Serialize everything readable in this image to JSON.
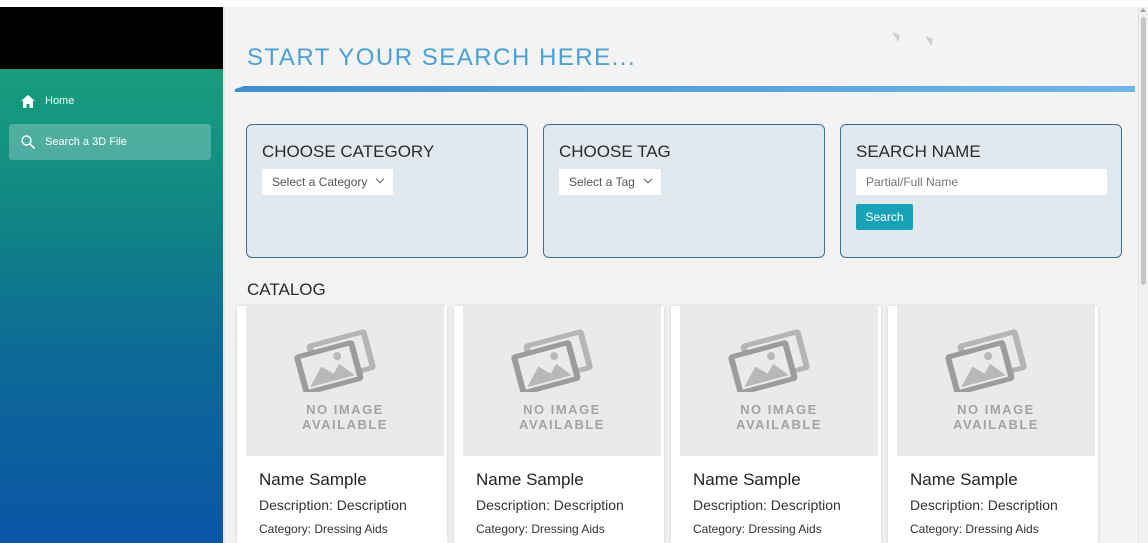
{
  "sidebar": {
    "items": [
      {
        "label": "Home",
        "icon": "home-icon"
      },
      {
        "label": "Search a 3D File",
        "icon": "search-icon"
      }
    ],
    "colors": {
      "gradient_top": "#1aa57e",
      "gradient_bottom": "#0b55a6"
    }
  },
  "main": {
    "title": "START YOUR SEARCH HERE...",
    "filters": {
      "category": {
        "title": "CHOOSE CATEGORY",
        "select_value": "Select a Category"
      },
      "tag": {
        "title": "CHOOSE TAG",
        "select_value": "Select a Tag"
      },
      "name": {
        "title": "SEARCH NAME",
        "placeholder": "Partial/Full Name",
        "button_label": "Search"
      }
    },
    "catalog": {
      "title": "CATALOG",
      "no_image_line1": "NO IMAGE",
      "no_image_line2": "AVAILABLE",
      "cards": [
        {
          "name": "Name Sample",
          "description": "Description: Description",
          "category": "Category: Dressing Aids"
        },
        {
          "name": "Name Sample",
          "description": "Description: Description",
          "category": "Category: Dressing Aids"
        },
        {
          "name": "Name Sample",
          "description": "Description: Description",
          "category": "Category: Dressing Aids"
        },
        {
          "name": "Name Sample",
          "description": "Description: Description",
          "category": "Category: Dressing Aids"
        }
      ]
    }
  },
  "colors": {
    "accent": "#4ba0d6",
    "button": "#17a2b8",
    "filter_bg": "#e1e9ee",
    "filter_border": "#3c6e8f"
  }
}
